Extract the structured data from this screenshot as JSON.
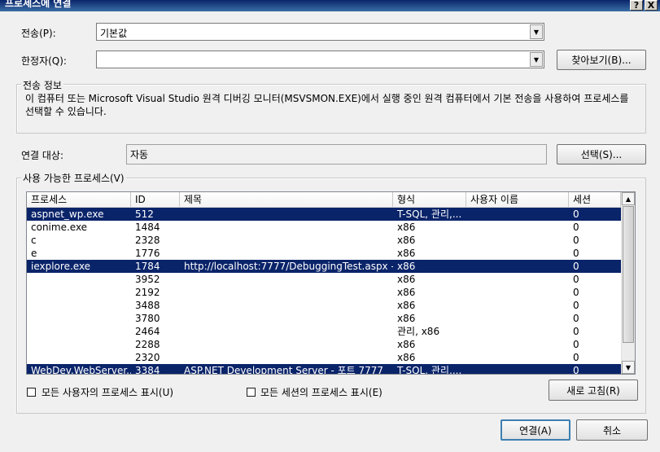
{
  "window": {
    "title": "프로세스에 연결",
    "help_glyph": "?",
    "close_glyph": "X"
  },
  "transport": {
    "label": "전송(P):",
    "value": "기본값"
  },
  "qualifier": {
    "label": "한정자(Q):",
    "value": "",
    "browse_label": "찾아보기(B)..."
  },
  "transport_info": {
    "title": "전송 정보",
    "text": "이 컴퓨터 또는 Microsoft Visual Studio 원격 디버깅 모니터(MSVSMON.EXE)에서 실행 중인 원격 컴퓨터에서 기본 전송을 사용하여 프로세스를 선택할 수 있습니다."
  },
  "attach_to": {
    "label": "연결 대상:",
    "value": "자동",
    "select_label": "선택(S)..."
  },
  "processes": {
    "title": "사용 가능한 프로세스(V)",
    "columns": [
      "프로세스",
      "ID",
      "제목",
      "형식",
      "사용자 이름",
      "세션"
    ],
    "rows": [
      {
        "process": "aspnet_wp.exe",
        "id": "512",
        "title": "",
        "type": "T-SQL, 관리,...",
        "user": "",
        "session": "0",
        "selected": true
      },
      {
        "process": "conime.exe",
        "id": "1484",
        "title": "",
        "type": "x86",
        "user": "",
        "session": "0",
        "selected": false
      },
      {
        "process": "c",
        "id": "2328",
        "title": "",
        "type": "x86",
        "user": "",
        "session": "0",
        "selected": false
      },
      {
        "process": "e",
        "id": "1776",
        "title": "",
        "type": "x86",
        "user": "",
        "session": "0",
        "selected": false
      },
      {
        "process": "iexplore.exe",
        "id": "1784",
        "title": "http://localhost:7777/DebuggingTest.aspx - ...",
        "type": "x86",
        "user": "",
        "session": "0",
        "selected": true
      },
      {
        "process": "",
        "id": "3952",
        "title": "",
        "type": "x86",
        "user": "",
        "session": "0",
        "selected": false
      },
      {
        "process": "",
        "id": "2192",
        "title": "",
        "type": "x86",
        "user": "",
        "session": "0",
        "selected": false
      },
      {
        "process": "",
        "id": "3488",
        "title": "",
        "type": "x86",
        "user": "",
        "session": "0",
        "selected": false
      },
      {
        "process": "",
        "id": "3780",
        "title": "",
        "type": "x86",
        "user": "",
        "session": "0",
        "selected": false
      },
      {
        "process": "",
        "id": "2464",
        "title": "",
        "type": "관리, x86",
        "user": "",
        "session": "0",
        "selected": false
      },
      {
        "process": "",
        "id": "2288",
        "title": "",
        "type": "x86",
        "user": "",
        "session": "0",
        "selected": false
      },
      {
        "process": "",
        "id": "2320",
        "title": "",
        "type": "x86",
        "user": "",
        "session": "0",
        "selected": false
      },
      {
        "process": "WebDev.WebServer....",
        "id": "3384",
        "title": "ASP.NET Development Server - 포트 7777",
        "type": "T-SQL, 관리,...",
        "user": "",
        "session": "0",
        "selected": true
      }
    ]
  },
  "options": {
    "all_users_label": "모든 사용자의 프로세스 표시(U)",
    "all_sessions_label": "모든 세션의 프로세스 표시(E)",
    "refresh_label": "새로 고침(R)"
  },
  "footer": {
    "attach_label": "연결(A)",
    "cancel_label": "취소"
  }
}
